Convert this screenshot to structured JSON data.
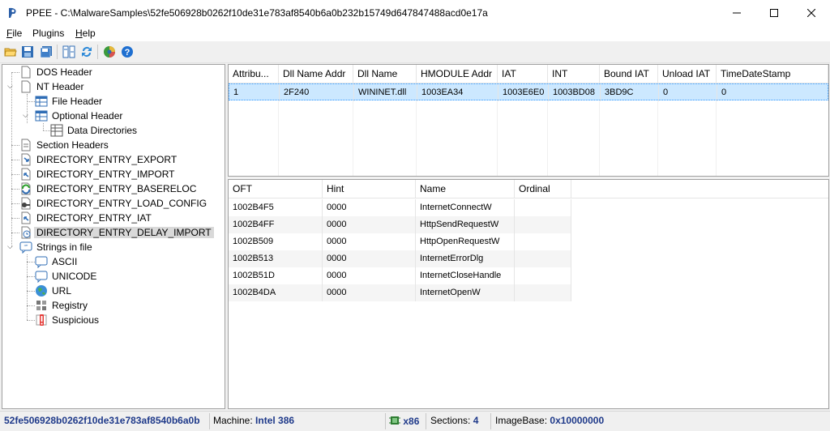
{
  "window": {
    "title": "PPEE - C:\\MalwareSamples\\52fe506928b0262f10de31e783af8540b6a0b232b15749d647847488acd0e17a",
    "minimize": "—",
    "maximize": "☐",
    "close": "✕"
  },
  "menu": {
    "file": {
      "hot": "F",
      "rest": "ile"
    },
    "plugins": {
      "label": "Plugins"
    },
    "help": {
      "hot": "H",
      "rest": "elp"
    }
  },
  "toolbar": {
    "icons": [
      "open-folder-icon",
      "save-icon",
      "save-all-icon",
      "compare-icon",
      "refresh-icon",
      "plugin-icon",
      "help-icon"
    ]
  },
  "tree": {
    "nodes": {
      "dos_header": "DOS Header",
      "nt_header": "NT Header",
      "file_header": "File Header",
      "optional_header": "Optional Header",
      "data_directories": "Data Directories",
      "section_headers": "Section Headers",
      "export": "DIRECTORY_ENTRY_EXPORT",
      "import": "DIRECTORY_ENTRY_IMPORT",
      "basereloc": "DIRECTORY_ENTRY_BASERELOC",
      "load_config": "DIRECTORY_ENTRY_LOAD_CONFIG",
      "iat": "DIRECTORY_ENTRY_IAT",
      "delay_import": "DIRECTORY_ENTRY_DELAY_IMPORT",
      "strings": "Strings in file",
      "ascii": "ASCII",
      "unicode": "UNICODE",
      "url": "URL",
      "registry": "Registry",
      "suspicious": "Suspicious"
    },
    "selected": "DIRECTORY_ENTRY_DELAY_IMPORT"
  },
  "delay_table": {
    "headers": [
      "Attribu...",
      "Dll Name Addr",
      "Dll Name",
      "HMODULE Addr",
      "IAT",
      "INT",
      "Bound IAT",
      "Unload IAT",
      "TimeDateStamp"
    ],
    "rows": [
      [
        "1",
        "2F240",
        "WININET.dll",
        "1003EA34",
        "1003E6E0",
        "1003BD08",
        "3BD9C",
        "0",
        "0"
      ]
    ]
  },
  "functions_table": {
    "headers": [
      "OFT",
      "Hint",
      "Name",
      "Ordinal"
    ],
    "rows": [
      [
        "1002B4F5",
        "0000",
        "InternetConnectW",
        ""
      ],
      [
        "1002B4FF",
        "0000",
        "HttpSendRequestW",
        ""
      ],
      [
        "1002B509",
        "0000",
        "HttpOpenRequestW",
        ""
      ],
      [
        "1002B513",
        "0000",
        "InternetErrorDlg",
        ""
      ],
      [
        "1002B51D",
        "0000",
        "InternetCloseHandle",
        ""
      ],
      [
        "1002B4DA",
        "0000",
        "InternetOpenW",
        ""
      ]
    ]
  },
  "status": {
    "hash": "52fe506928b0262f10de31e783af8540b6a0b",
    "machine_label": "Machine:",
    "machine_value": "Intel 386",
    "arch": "x86",
    "sections_label": "Sections:",
    "sections_value": "4",
    "imagebase_label": "ImageBase:",
    "imagebase_value": "0x10000000"
  },
  "colors": {
    "selection": "#cce8ff",
    "status_value": "#1f3a8a"
  }
}
